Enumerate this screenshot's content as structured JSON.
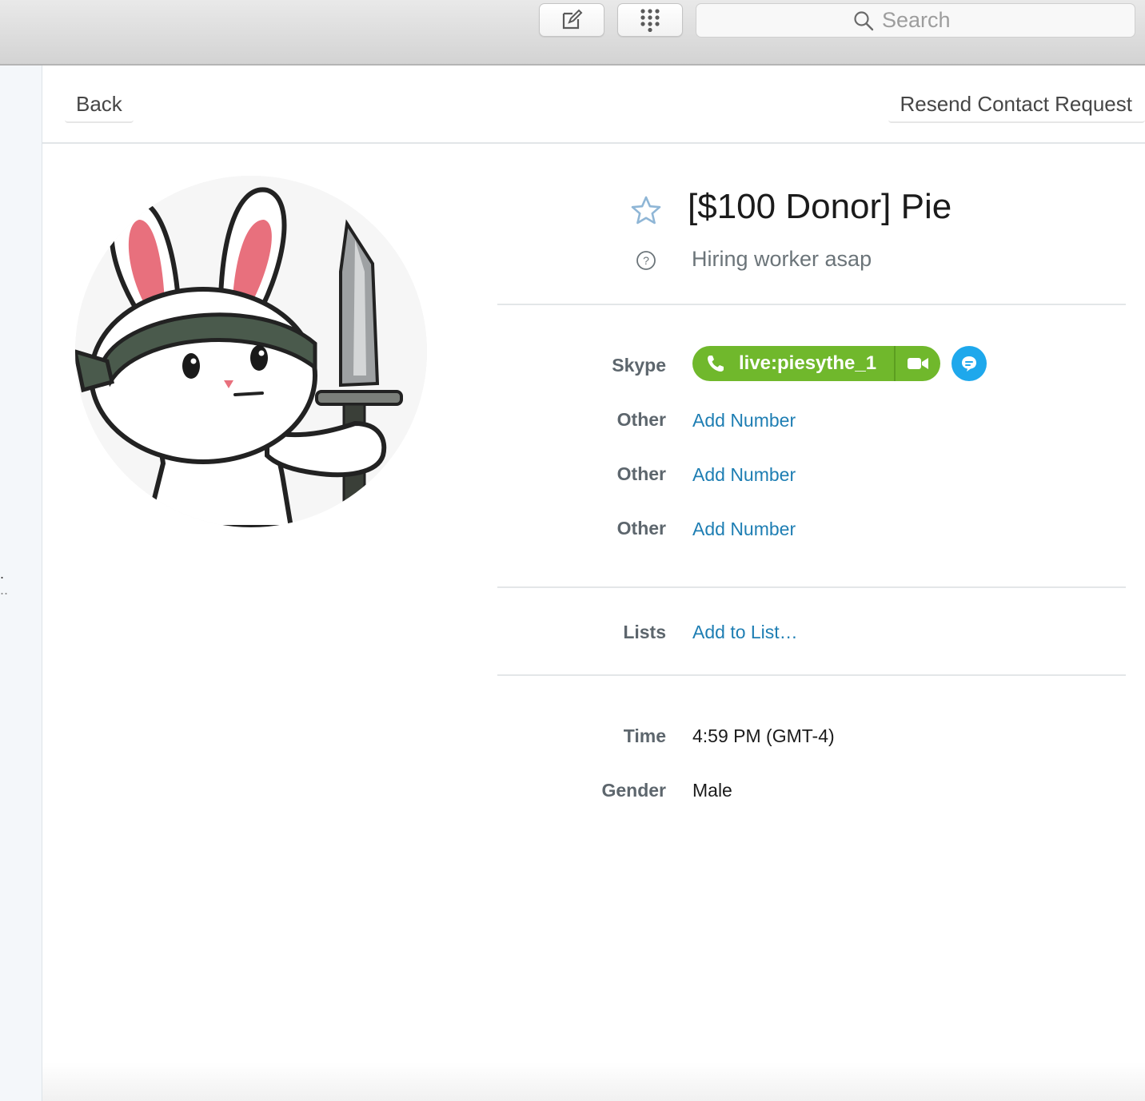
{
  "toolbar": {
    "compose_icon": "compose-icon",
    "dialpad_icon": "dialpad-icon",
    "search_placeholder": "Search"
  },
  "nav": {
    "back_label": "Back",
    "resend_label": "Resend Contact Request"
  },
  "profile": {
    "display_name": "[$100 Donor] Pie",
    "mood": "Hiring worker asap",
    "avatar": "bunny-with-knife-avatar"
  },
  "contact": {
    "skype_label": "Skype",
    "skype_handle": "live:piesythe_1",
    "phones": [
      {
        "label": "Other",
        "action": "Add Number"
      },
      {
        "label": "Other",
        "action": "Add Number"
      },
      {
        "label": "Other",
        "action": "Add Number"
      }
    ],
    "lists_label": "Lists",
    "lists_action": "Add to List…",
    "time_label": "Time",
    "time_value": "4:59 PM (GMT-4)",
    "gender_label": "Gender",
    "gender_value": "Male"
  },
  "colors": {
    "call_green": "#70b82c",
    "chat_blue": "#1ea8ec",
    "link_blue": "#1e7eb3"
  }
}
